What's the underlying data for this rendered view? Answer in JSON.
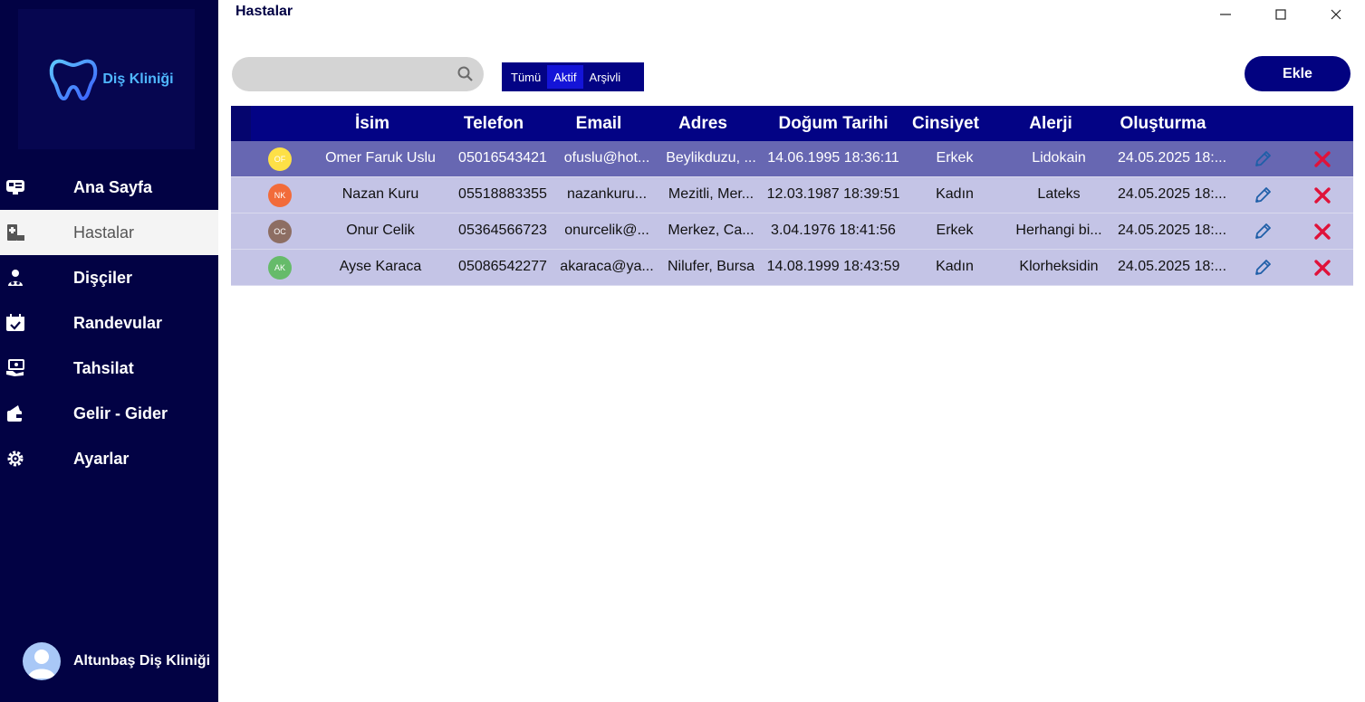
{
  "window": {
    "title": "Hastalar"
  },
  "sidebar": {
    "logo_text": "Diş Kliniği",
    "items": [
      {
        "label": "Ana Sayfa",
        "icon": "dashboard-icon",
        "active": false
      },
      {
        "label": "Hastalar",
        "icon": "patient-icon",
        "active": true
      },
      {
        "label": "Dişçiler",
        "icon": "doctor-icon",
        "active": false
      },
      {
        "label": "Randevular",
        "icon": "calendar-icon",
        "active": false
      },
      {
        "label": "Tahsilat",
        "icon": "payment-icon",
        "active": false
      },
      {
        "label": "Gelir - Gider",
        "icon": "wallet-icon",
        "active": false
      },
      {
        "label": "Ayarlar",
        "icon": "settings-icon",
        "active": false
      }
    ],
    "user_name": "Altunbaş Diş Kliniği"
  },
  "toolbar": {
    "search_placeholder": "",
    "filters": [
      "Tümü",
      "Aktif",
      "Arşivli"
    ],
    "active_filter": "Aktif",
    "add_label": "Ekle"
  },
  "table": {
    "headers": [
      "İsim",
      "Telefon",
      "Email",
      "Adres",
      "Doğum Tarihi",
      "Cinsiyet",
      "Alerji",
      "Oluşturma"
    ],
    "rows": [
      {
        "initials": "OF",
        "avatar_color": "#fde047",
        "name": "Omer Faruk Uslu",
        "phone": "05016543421",
        "email": "ofuslu@hot...",
        "address": "Beylikduzu, ...",
        "birth": "14.06.1995 18:36:11",
        "gender": "Erkek",
        "allergy": "Lidokain",
        "created": "24.05.2025 18:..."
      },
      {
        "initials": "NK",
        "avatar_color": "#f26b3a",
        "name": "Nazan Kuru",
        "phone": "05518883355",
        "email": "nazankuru...",
        "address": "Mezitli, Mer...",
        "birth": "12.03.1987 18:39:51",
        "gender": "Kadın",
        "allergy": "Lateks",
        "created": "24.05.2025 18:..."
      },
      {
        "initials": "OC",
        "avatar_color": "#8d6e63",
        "name": "Onur Celik",
        "phone": "05364566723",
        "email": "onurcelik@...",
        "address": "Merkez, Ca...",
        "birth": "3.04.1976 18:41:56",
        "gender": "Erkek",
        "allergy": "Herhangi bi...",
        "created": "24.05.2025 18:..."
      },
      {
        "initials": "AK",
        "avatar_color": "#66bb6a",
        "name": "Ayse Karaca",
        "phone": "05086542277",
        "email": "akaraca@ya...",
        "address": "Nilufer, Bursa",
        "birth": "14.08.1999 18:43:59",
        "gender": "Kadın",
        "allergy": "Klorheksidin",
        "created": "24.05.2025 18:..."
      }
    ]
  },
  "colors": {
    "sidebar_bg": "#020244",
    "header_bg": "#030385",
    "row_selected": "#6767b2",
    "row_normal": "#c4c4e6",
    "delete": "#e0123a",
    "edit": "#1f5fa8"
  }
}
